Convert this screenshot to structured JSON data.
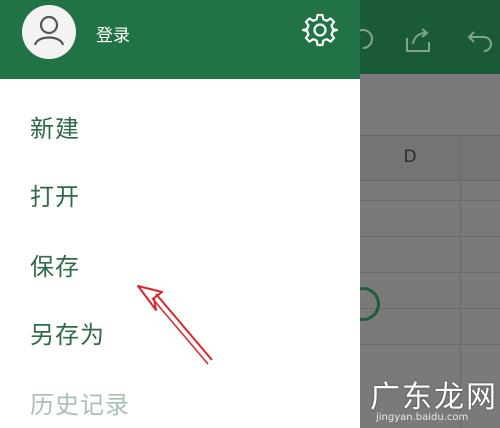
{
  "drawer": {
    "login_label": "登录",
    "menu": [
      {
        "label": "新建",
        "enabled": true
      },
      {
        "label": "打开",
        "enabled": true
      },
      {
        "label": "保存",
        "enabled": true
      },
      {
        "label": "另存为",
        "enabled": true
      },
      {
        "label": "历史记录",
        "enabled": false
      }
    ]
  },
  "sheet": {
    "column_label": "D"
  },
  "watermark": {
    "title": "广东龙网",
    "url": "jingyan.baidu.com"
  },
  "colors": {
    "header_green": "#217346",
    "menu_text": "#2f6b47",
    "menu_disabled": "#a9c2b3",
    "annotation_red": "#d9262b"
  },
  "icons": [
    "user-avatar-icon",
    "gear-icon",
    "share-icon",
    "undo-icon",
    "arrow-annotation"
  ]
}
